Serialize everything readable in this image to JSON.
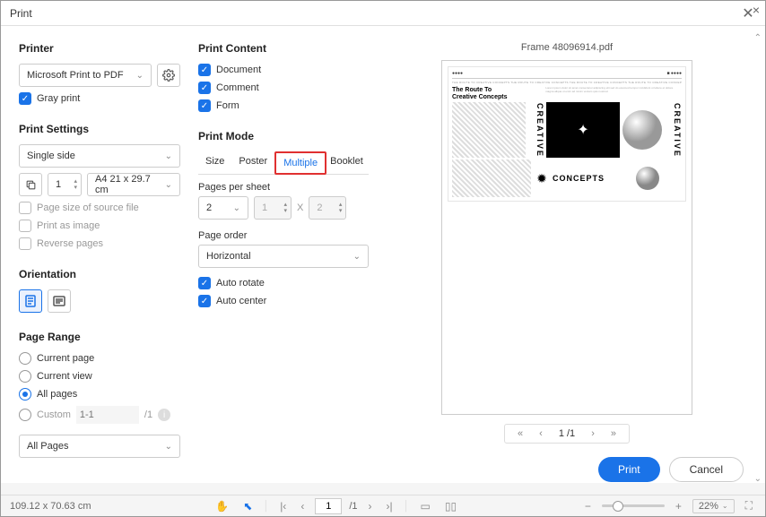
{
  "window": {
    "title": "Print"
  },
  "col1": {
    "printer_h": "Printer",
    "printer_select": "Microsoft Print to PDF",
    "gray_print": "Gray print",
    "settings_h": "Print Settings",
    "side_select": "Single side",
    "copies": "1",
    "paper": "A4 21 x 29.7 cm",
    "pg_source": "Page size of source file",
    "print_img": "Print as image",
    "reverse": "Reverse pages",
    "orientation_h": "Orientation",
    "range_h": "Page Range",
    "r_current_page": "Current page",
    "r_current_view": "Current view",
    "r_all_pages": "All pages",
    "r_custom": "Custom",
    "custom_ph": "1-1",
    "custom_total": "/1",
    "all_pages_select": "All Pages"
  },
  "col2": {
    "content_h": "Print Content",
    "c_document": "Document",
    "c_comment": "Comment",
    "c_form": "Form",
    "mode_h": "Print Mode",
    "tab_size": "Size",
    "tab_poster": "Poster",
    "tab_multiple": "Multiple",
    "tab_booklet": "Booklet",
    "pps_label": "Pages per sheet",
    "pps_value": "2",
    "pps_x": "X",
    "pps_w": "1",
    "pps_h": "2",
    "order_label": "Page order",
    "order_value": "Horizontal",
    "auto_rotate": "Auto rotate",
    "auto_center": "Auto center"
  },
  "preview": {
    "filename": "Frame 48096914.pdf",
    "title1": "The Route To",
    "title2": "Creative Concepts",
    "word1": "CREATIVE",
    "word2": "CONCEPTS",
    "word3": "CREATIVE",
    "pagenum": "1",
    "pagetotal": "/1"
  },
  "buttons": {
    "print": "Print",
    "cancel": "Cancel"
  },
  "status": {
    "dims": "109.12 x 70.63 cm",
    "page": "1",
    "total": "/1",
    "zoom": "22%"
  }
}
